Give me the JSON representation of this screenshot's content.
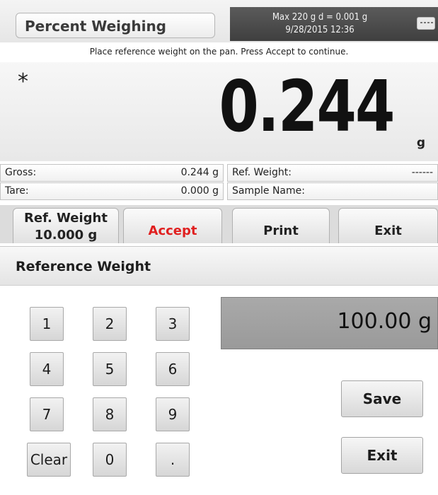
{
  "header": {
    "mode_title": "Percent Weighing",
    "capacity": "Max 220 g  d = 0.001 g",
    "datetime": "9/28/2015  12:36",
    "keyboard_icon": "keyboard-icon"
  },
  "instruction": "Place reference weight on the pan. Press Accept to continue.",
  "display": {
    "stability_marker": "*",
    "weight": "0.244",
    "unit": "g"
  },
  "info": {
    "gross_label": "Gross:",
    "gross_value": "0.244 g",
    "tare_label": "Tare:",
    "tare_value": "0.000 g",
    "ref_weight_label": "Ref. Weight:",
    "ref_weight_value": "------",
    "sample_name_label": "Sample Name:",
    "sample_name_value": ""
  },
  "buttons": {
    "ref_weight_line1": "Ref. Weight",
    "ref_weight_line2": "10.000 g",
    "accept": "Accept",
    "print": "Print",
    "exit": "Exit"
  },
  "dialog": {
    "title": "Reference Weight",
    "entry_value": "100.00 g",
    "keys": [
      "1",
      "2",
      "3",
      "4",
      "5",
      "6",
      "7",
      "8",
      "9",
      "Clear",
      "0",
      "."
    ],
    "save": "Save",
    "exit": "Exit"
  },
  "colors": {
    "accept_text": "#e02020",
    "status_bg": "#4a4a4a",
    "entry_bg": "#a3a3a3"
  }
}
